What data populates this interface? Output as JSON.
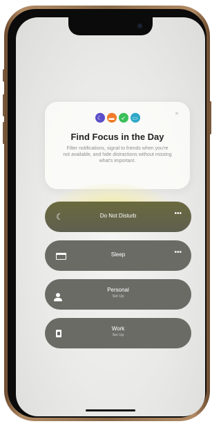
{
  "card": {
    "close_icon": "×",
    "icons": [
      "moon-icon",
      "bed-icon",
      "runner-icon",
      "car-icon"
    ],
    "title": "Find Focus in the Day",
    "description": "Filter notifications, signal to friends when you're not available, and hide distractions without missing what's important."
  },
  "focus_modes": [
    {
      "name": "Do Not Disturb",
      "icon": "moon-icon",
      "more": "•••"
    },
    {
      "name": "Sleep",
      "icon": "bed-icon",
      "more": "•••"
    },
    {
      "name": "Personal",
      "subtitle": "Set Up",
      "icon": "person-icon"
    },
    {
      "name": "Work",
      "subtitle": "Set Up",
      "icon": "badge-icon"
    }
  ],
  "colors": {
    "dnd_accent": "#5a4fc8",
    "sleep_accent": "#f07c2a",
    "fitness_accent": "#3bbf5a",
    "driving_accent": "#2fa8c8",
    "glow": "#f0e896"
  }
}
